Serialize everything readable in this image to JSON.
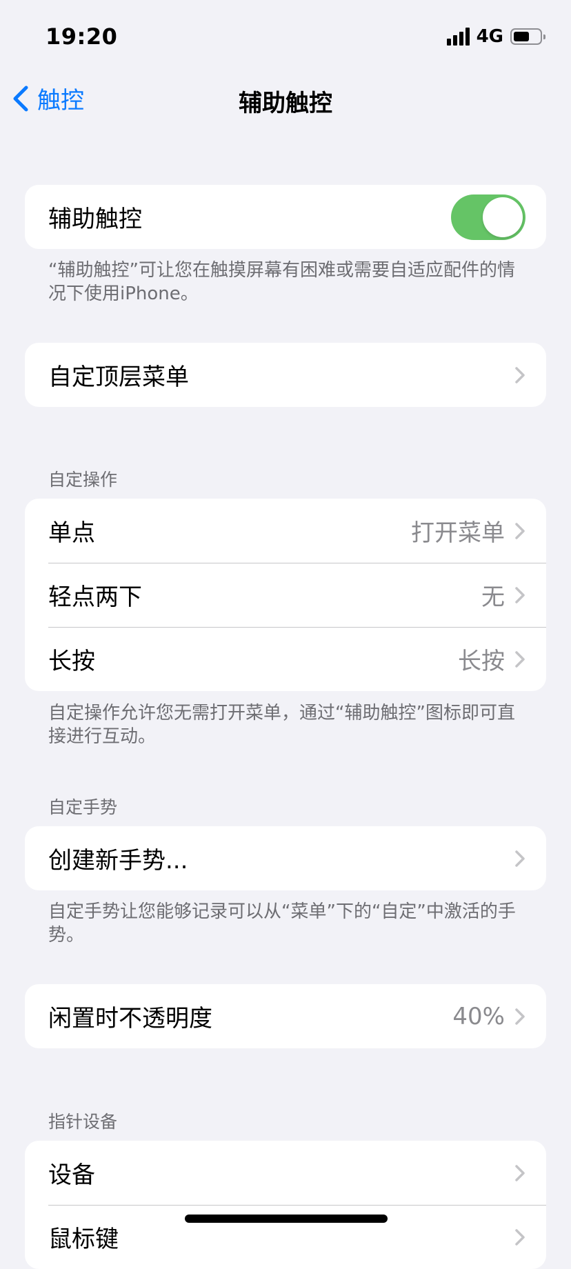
{
  "status": {
    "time": "19:20",
    "network": "4G",
    "battery_level": 0.6
  },
  "nav": {
    "back_label": "触控",
    "title": "辅助触控"
  },
  "main_toggle": {
    "label": "辅助触控",
    "on": true,
    "footer": "“辅助触控”可让您在触摸屏幕有困难或需要自适应配件的情况下使用iPhone。"
  },
  "top_menu": {
    "label": "自定顶层菜单"
  },
  "custom_actions": {
    "header": "自定操作",
    "items": [
      {
        "label": "单点",
        "value": "打开菜单"
      },
      {
        "label": "轻点两下",
        "value": "无"
      },
      {
        "label": "长按",
        "value": "长按"
      }
    ],
    "footer": "自定操作允许您无需打开菜单，通过“辅助触控”图标即可直接进行互动。"
  },
  "custom_gestures": {
    "header": "自定手势",
    "create_label": "创建新手势...",
    "footer": "自定手势让您能够记录可以从“菜单”下的“自定”中激活的手势。"
  },
  "idle_opacity": {
    "label": "闲置时不透明度",
    "value": "40%"
  },
  "pointer_devices": {
    "header": "指针设备",
    "items": [
      {
        "label": "设备"
      },
      {
        "label": "鼠标键"
      }
    ]
  },
  "colors": {
    "accent": "#0a7aff",
    "toggle_on": "#65c466",
    "background": "#f2f2f7"
  }
}
